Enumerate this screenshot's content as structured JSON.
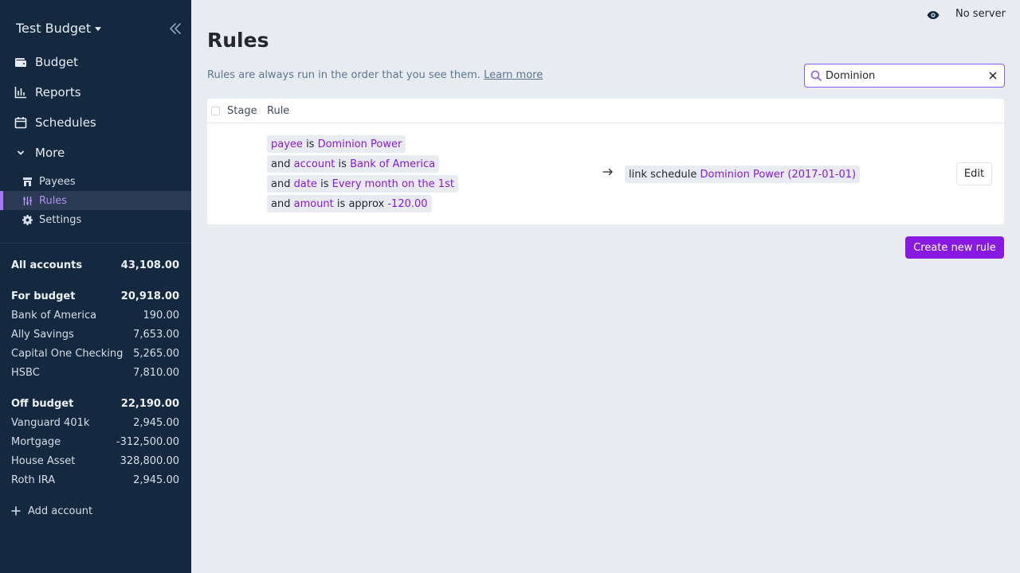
{
  "sidebar": {
    "budget_name": "Test Budget",
    "nav": [
      {
        "label": "Budget",
        "icon": "wallet-icon"
      },
      {
        "label": "Reports",
        "icon": "bar-chart-icon"
      },
      {
        "label": "Schedules",
        "icon": "calendar-icon"
      },
      {
        "label": "More",
        "icon": "chevron-down-icon"
      }
    ],
    "more_items": [
      {
        "label": "Payees",
        "icon": "store-icon"
      },
      {
        "label": "Rules",
        "icon": "sliders-icon",
        "active": true
      },
      {
        "label": "Settings",
        "icon": "gear-icon"
      }
    ],
    "accounts": {
      "all": {
        "label": "All accounts",
        "amount": "43,108.00"
      },
      "for_budget": {
        "label": "For budget",
        "amount": "20,918.00",
        "items": [
          {
            "name": "Bank of America",
            "amount": "190.00"
          },
          {
            "name": "Ally Savings",
            "amount": "7,653.00"
          },
          {
            "name": "Capital One Checking",
            "amount": "5,265.00"
          },
          {
            "name": "HSBC",
            "amount": "7,810.00"
          }
        ]
      },
      "off_budget": {
        "label": "Off budget",
        "amount": "22,190.00",
        "items": [
          {
            "name": "Vanguard 401k",
            "amount": "2,945.00"
          },
          {
            "name": "Mortgage",
            "amount": "-312,500.00"
          },
          {
            "name": "House Asset",
            "amount": "328,800.00"
          },
          {
            "name": "Roth IRA",
            "amount": "2,945.00"
          }
        ]
      }
    },
    "add_account_label": "Add account"
  },
  "topbar": {
    "server_status": "No server"
  },
  "page": {
    "title": "Rules",
    "subtitle": "Rules are always run in the order that you see them.",
    "learn_more": "Learn more",
    "search_value": "Dominion",
    "create_label": "Create new rule"
  },
  "table": {
    "headers": {
      "stage": "Stage",
      "rule": "Rule"
    },
    "rows": [
      {
        "conditions": [
          {
            "prefix": "",
            "field": "payee",
            "op": "is",
            "value": "Dominion Power"
          },
          {
            "prefix": "and",
            "field": "account",
            "op": "is",
            "value": "Bank of America"
          },
          {
            "prefix": "and",
            "field": "date",
            "op": "is",
            "value": "Every month on the 1st"
          },
          {
            "prefix": "and",
            "field": "amount",
            "op": "is approx",
            "value": "-120.00"
          }
        ],
        "action": {
          "text": "link schedule",
          "value": "Dominion Power (2017-01-01)"
        },
        "edit_label": "Edit"
      }
    ]
  },
  "colors": {
    "sidebar_bg": "#14283f",
    "accent": "#8719e0",
    "active_nav": "#b592f2",
    "page_bg": "#e8ecf0"
  }
}
